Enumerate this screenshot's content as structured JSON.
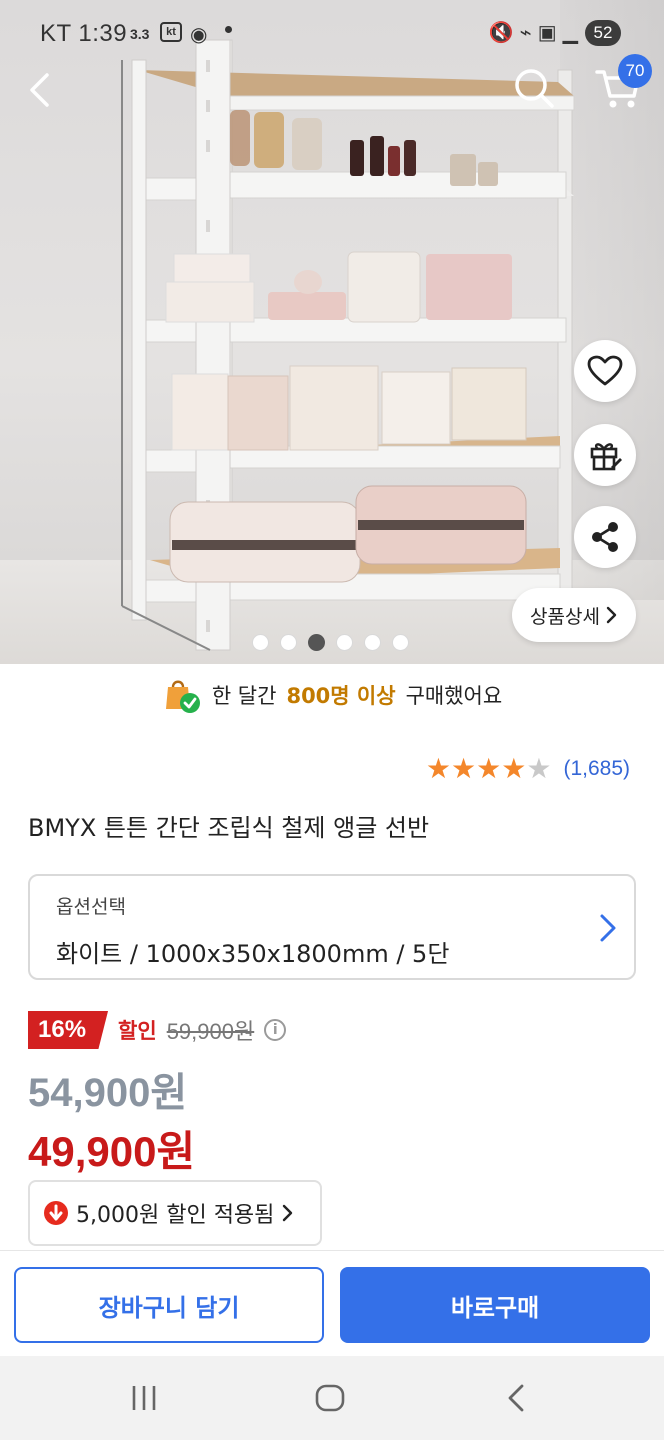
{
  "status_bar": {
    "carrier_time": "KT 1:39",
    "network_speed": "3.3",
    "kt_label": "kt",
    "battery": "52"
  },
  "header": {
    "cart_count": "70"
  },
  "gallery": {
    "detail_label": "상품상세",
    "image_count": 6,
    "active_index": 2
  },
  "purchase_notice": {
    "prefix": "한 달간",
    "highlight": "800명 이상",
    "suffix": "구매했어요"
  },
  "rating": {
    "stars": 4,
    "review_count": "(1,685)"
  },
  "product": {
    "title": "BMYX 튼튼 간단 조립식 철제 앵글 선반"
  },
  "option": {
    "label": "옵션선택",
    "value": "화이트 / 1000x350x1800mm / 5단"
  },
  "pricing": {
    "discount_percent": "16%",
    "discount_word": "할인",
    "original_price": "59,900원",
    "sale_price": "54,900원",
    "final_price": "49,900원",
    "coupon_text": "5,000원 할인 적용됨"
  },
  "actions": {
    "cart_label": "장바구니 담기",
    "buy_label": "바로구매"
  },
  "colors": {
    "accent_blue": "#3470e8",
    "sale_red": "#c81a1a",
    "star_orange": "#f4872b",
    "highlight_gold": "#c27a00"
  }
}
